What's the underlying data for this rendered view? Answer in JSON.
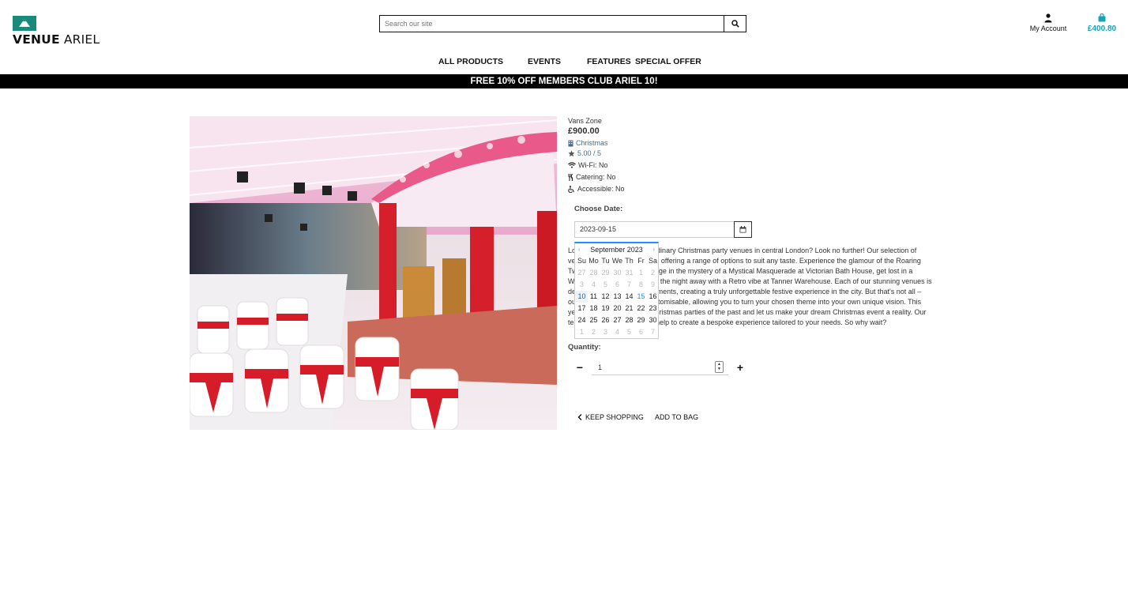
{
  "brand": {
    "logo_bold": "VENUE",
    "logo_rest": " ARIEL",
    "accent": "#1a8a7a"
  },
  "search": {
    "placeholder": "Search our site",
    "icon": "search-icon"
  },
  "account": {
    "label": "My Account",
    "icon": "user-icon"
  },
  "bag": {
    "total": "£400.80",
    "icon": "shopping-bag-icon",
    "color": "#17a2b8"
  },
  "nav": {
    "items": [
      "ALL PRODUCTS",
      "EVENTS",
      "FEATURES",
      "SPECIAL OFFER"
    ]
  },
  "banner": {
    "text": "FREE 10% OFF MEMBERS CLUB ARIEL 10!"
  },
  "product": {
    "name": "Vans Zone",
    "price": "£900.00",
    "category": "Christmas",
    "rating": "5.00 / 5",
    "wifi": "Wi-Fi: No",
    "catering": "Catering: No",
    "accessible": "Accessible: No",
    "description": "Looking for the most extraordinary Christmas party venues in central London? Look no further! Our selection of venues offer themed spaces, offering a range of options to suit any taste. Experience the glamour of the Roaring Twenties at Vans Zone, indulge in the mystery of a Mystical Masquerade at Victorian Bath House, get lost in a Winter Wonderland or dance the night away with a Retro vibe at Tanner Warehouse. Each of our stunning venues is decorated with festive adornments, creating a truly unforgettable festive experience in the city. But that's not all – our venues are also fully customisable, allowing you to turn your chosen theme into your own unique vision. This year, forget about the dull Christmas parties of the past and let us make your dream Christmas event a reality. Our team of event planners can help to create a bespoke experience tailored to your needs. So why wait?"
  },
  "date_picker": {
    "label": "Choose Date:",
    "value": "2023-09-15",
    "icon": "calendar-icon",
    "month_label": "September 2023",
    "prev": "‹",
    "next": "›",
    "weekdays": [
      "Su",
      "Mo",
      "Tu",
      "We",
      "Th",
      "Fr",
      "Sa"
    ],
    "weeks": [
      [
        "27",
        "28",
        "29",
        "30",
        "31",
        "1",
        "2"
      ],
      [
        "3",
        "4",
        "5",
        "6",
        "7",
        "8",
        "9"
      ],
      [
        "10",
        "11",
        "12",
        "13",
        "14",
        "15",
        "16"
      ],
      [
        "17",
        "18",
        "19",
        "20",
        "21",
        "22",
        "23"
      ],
      [
        "24",
        "25",
        "26",
        "27",
        "28",
        "29",
        "30"
      ],
      [
        "1",
        "2",
        "3",
        "4",
        "5",
        "6",
        "7"
      ]
    ],
    "muted_weeks": [
      0,
      1,
      5
    ],
    "today": "10",
    "selected": "15"
  },
  "quantity": {
    "label": "Quantity:",
    "value": "1",
    "minus": "−",
    "plus": "+"
  },
  "actions": {
    "keep_shopping": "KEEP SHOPPING",
    "add_to_bag": "ADD TO BAG"
  }
}
